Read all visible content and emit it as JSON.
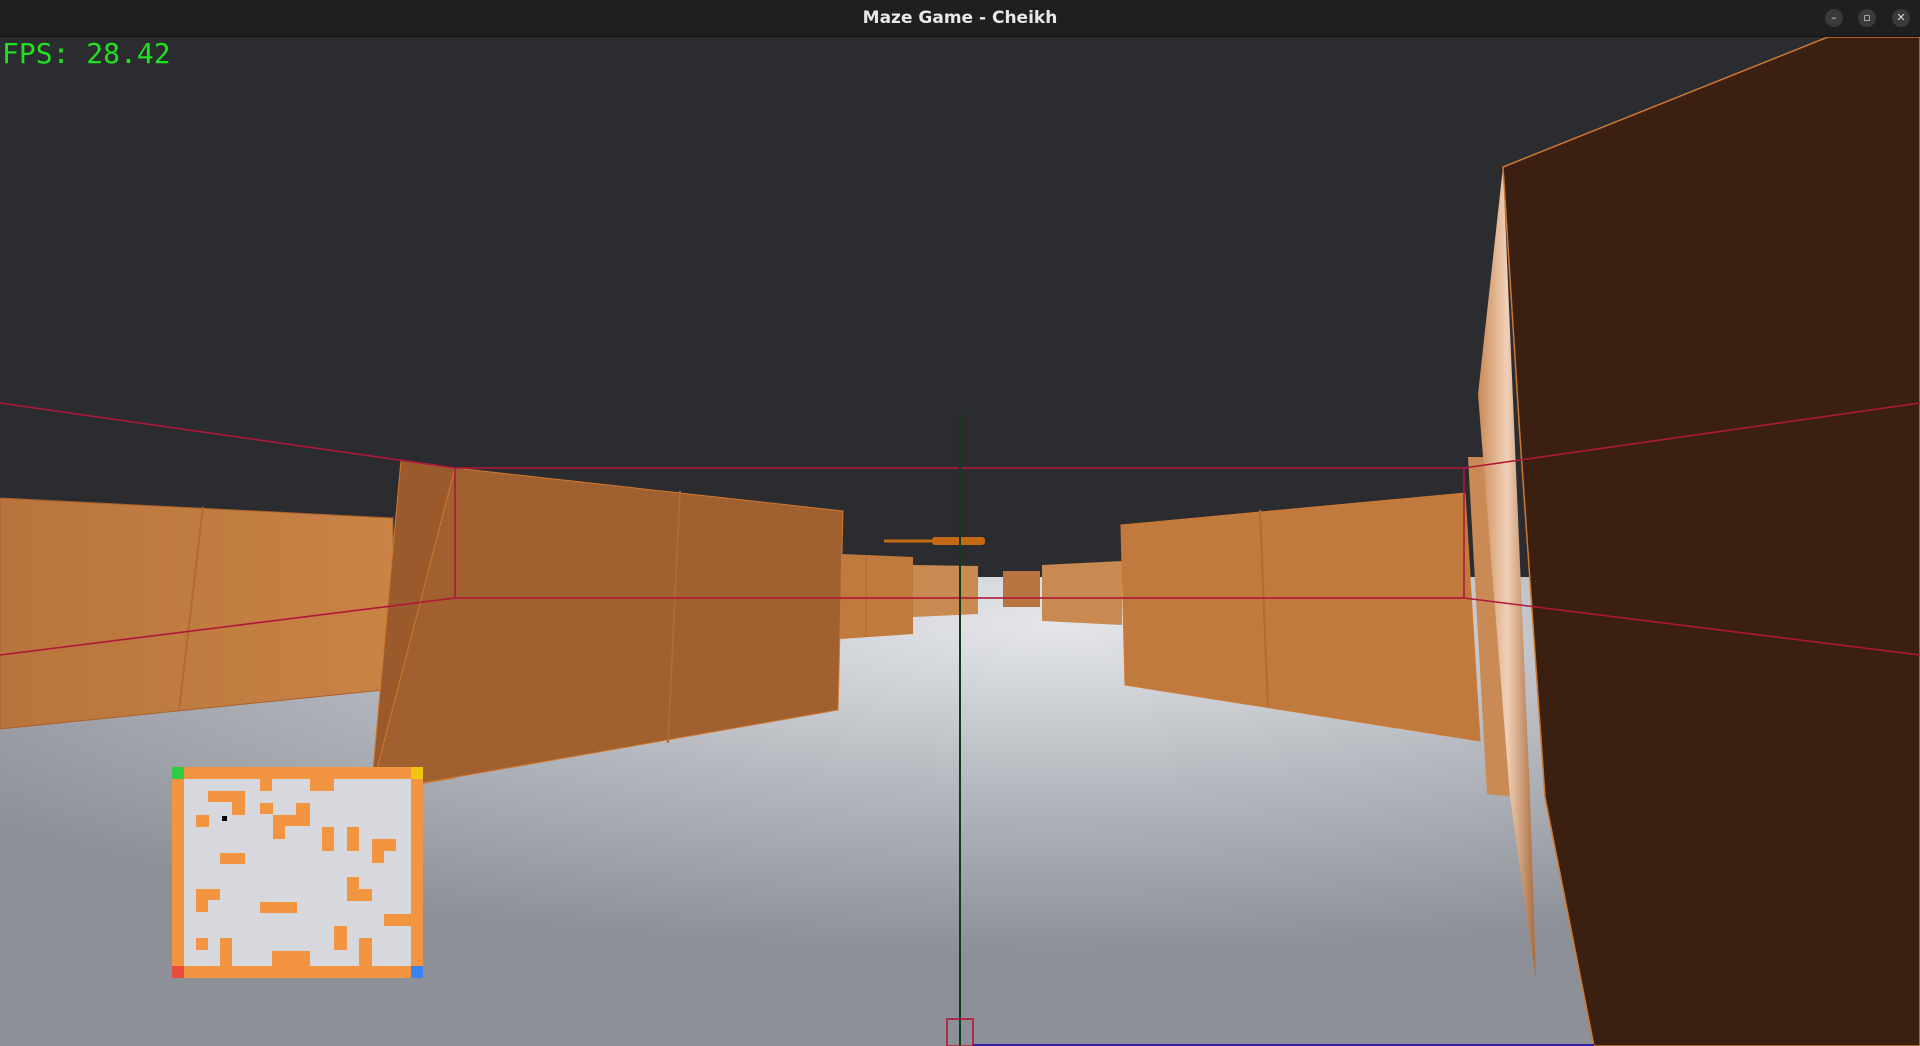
{
  "window": {
    "title": "Maze Game - Cheikh",
    "minimize_icon": "–",
    "maximize_icon": "▫",
    "close_icon": "✕"
  },
  "hud": {
    "fps_label": "FPS: 28.42"
  },
  "colors": {
    "sky": "#2b2c30",
    "floor": "#a9abb1",
    "wall": "#c07a3e",
    "wall_shadow": "#3b1f10",
    "guide_lines": "#b0173a",
    "crosshair": "#0e3a1e",
    "fps_text": "#22e022",
    "minimap_wall": "#f39440",
    "minimap_floor": "#d6d8de",
    "minimap_player": "#000000",
    "corner_start": "#2ecc40",
    "corner_goal": "#f1c40f",
    "corner_red": "#e74c3c",
    "corner_blue": "#3b82f6"
  },
  "minimap": {
    "label": "minimap",
    "player_marker": "player"
  }
}
